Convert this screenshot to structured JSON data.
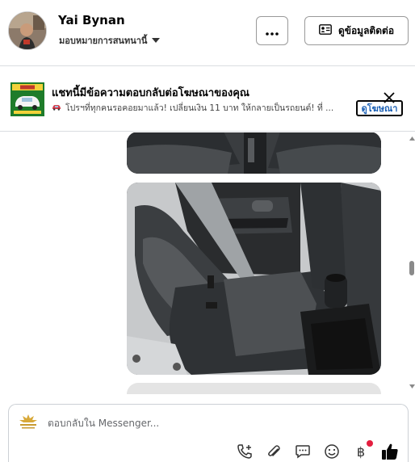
{
  "header": {
    "user_name": "Yai Bynan",
    "assign_label": "มอบหมายการสนทนานี้",
    "more_label": "···",
    "contact_button_label": "ดูข้อมูลติดต่อ"
  },
  "ad_banner": {
    "title": "แชทนี้มีข้อความตอบกลับต่อโฆษณาของคุณ",
    "text": "โปรฯที่ทุกคนรอคอยมาแล้ว! เปลี่ยนเงิน 11 บาท ให้กลายเป็นรถยนต์! ที่ ...",
    "view_ad_label": "ดูโฆษณา",
    "close_icon": "close-icon"
  },
  "composer": {
    "placeholder": "ตอบกลับใน Messenger...",
    "tools": [
      "add-call-icon",
      "attachment-icon",
      "saved-reply-icon",
      "emoji-icon",
      "baht-payment-icon",
      "like-icon"
    ],
    "baht_symbol": "฿"
  },
  "colors": {
    "accent": "#1a5fb4",
    "like": "#0064d1",
    "notification": "#e41e3f",
    "ad_thumb": "#1e7c2a"
  }
}
